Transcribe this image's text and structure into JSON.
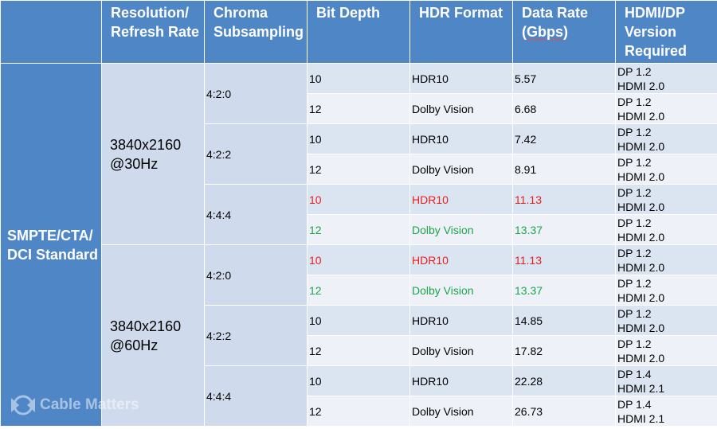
{
  "header": {
    "resolution": [
      "Resolution/",
      "Refresh Rate"
    ],
    "chroma": [
      "Chroma",
      "Subsampling"
    ],
    "bit_depth": "Bit Depth",
    "hdr_format": "HDR Format",
    "data_rate": [
      "Data Rate",
      "(Gbps)"
    ],
    "version": [
      "HDMI/DP",
      "Version",
      "Required"
    ]
  },
  "standard": [
    "SMPTE/CTA/",
    "DCI Standard"
  ],
  "groups": [
    {
      "resolution": [
        "3840x2160",
        "@30Hz"
      ],
      "chroma": [
        {
          "name": "4:2:0",
          "rows": [
            {
              "bit": "10",
              "hdr": "HDR10",
              "rate": "5.57",
              "dp": "DP 1.2",
              "hdmi": "HDMI 2.0",
              "color": ""
            },
            {
              "bit": "12",
              "hdr": "Dolby Vision",
              "rate": "6.68",
              "dp": "DP 1.2",
              "hdmi": "HDMI 2.0",
              "color": ""
            }
          ]
        },
        {
          "name": "4:2:2",
          "rows": [
            {
              "bit": "10",
              "hdr": "HDR10",
              "rate": "7.42",
              "dp": "DP 1.2",
              "hdmi": "HDMI 2.0",
              "color": ""
            },
            {
              "bit": "12",
              "hdr": "Dolby Vision",
              "rate": "8.91",
              "dp": "DP 1.2",
              "hdmi": "HDMI 2.0",
              "color": ""
            }
          ]
        },
        {
          "name": "4:4:4",
          "rows": [
            {
              "bit": "10",
              "hdr": "HDR10",
              "rate": "11.13",
              "dp": "DP 1.2",
              "hdmi": "HDMI 2.0",
              "color": "red"
            },
            {
              "bit": "12",
              "hdr": "Dolby Vision",
              "rate": "13.37",
              "dp": "DP 1.2",
              "hdmi": "HDMI 2.0",
              "color": "green"
            }
          ]
        }
      ]
    },
    {
      "resolution": [
        "3840x2160",
        "@60Hz"
      ],
      "chroma": [
        {
          "name": "4:2:0",
          "rows": [
            {
              "bit": "10",
              "hdr": "HDR10",
              "rate": "11.13",
              "dp": "DP 1.2",
              "hdmi": "HDMI 2.0",
              "color": "red"
            },
            {
              "bit": "12",
              "hdr": "Dolby Vision",
              "rate": "13.37",
              "dp": "DP 1.2",
              "hdmi": "HDMI 2.0",
              "color": "green"
            }
          ]
        },
        {
          "name": "4:2:2",
          "rows": [
            {
              "bit": "10",
              "hdr": "HDR10",
              "rate": "14.85",
              "dp": "DP 1.2",
              "hdmi": "HDMI 2.0",
              "color": ""
            },
            {
              "bit": "12",
              "hdr": "Dolby Vision",
              "rate": "17.82",
              "dp": "DP 1.2",
              "hdmi": "HDMI 2.0",
              "color": ""
            }
          ]
        },
        {
          "name": "4:4:4",
          "rows": [
            {
              "bit": "10",
              "hdr": "HDR10",
              "rate": "22.28",
              "dp": "DP 1.4",
              "hdmi": "HDMI 2.1",
              "color": ""
            },
            {
              "bit": "12",
              "hdr": "Dolby Vision",
              "rate": "26.73",
              "dp": "DP 1.4",
              "hdmi": "HDMI 2.1",
              "color": ""
            }
          ]
        }
      ]
    }
  ],
  "colors": {
    "header_blue": "#4f86c6",
    "highlight_red": "#e8201c",
    "highlight_green": "#1fa34a"
  },
  "watermark": {
    "text": "Cable Matters",
    "icon": "cable-matters-logo-icon"
  }
}
